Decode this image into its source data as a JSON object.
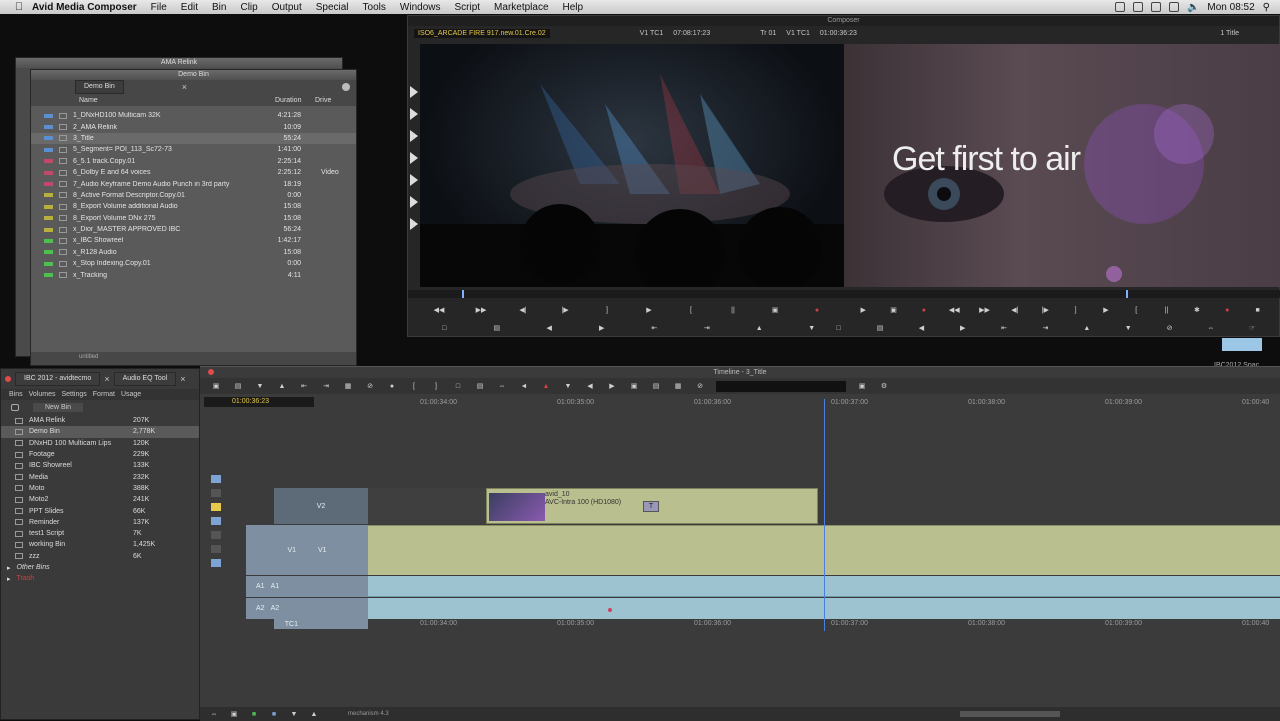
{
  "menubar": {
    "app_name": "Avid Media Composer",
    "menus": [
      "File",
      "Edit",
      "Bin",
      "Clip",
      "Output",
      "Special",
      "Tools",
      "Windows",
      "Script",
      "Marketplace",
      "Help"
    ],
    "clock": "Mon 08:52"
  },
  "bins": {
    "ama_title": "AMA Relink",
    "demo_title": "Demo Bin",
    "tab_label": "Demo Bin",
    "col_name": "Name",
    "col_duration": "Duration",
    "col_drive": "Drive",
    "footer_label": "untitled",
    "items": [
      {
        "name": "1_DNxHD100 Multicam 32K",
        "duration": "4:21:28",
        "color": "#5b8fd0",
        "sel": false
      },
      {
        "name": "2_AMA Relink",
        "duration": "10:09",
        "color": "#5b8fd0",
        "sel": false
      },
      {
        "name": "3_Title",
        "duration": "55:24",
        "color": "#5b8fd0",
        "sel": true
      },
      {
        "name": "5_Segment= POI_113_Sc72-73",
        "duration": "1:41:00",
        "color": "#5b8fd0",
        "sel": false
      },
      {
        "name": "6_5.1 track.Copy.01",
        "duration": "2:25:14",
        "color": "#c04a6a",
        "sel": false
      },
      {
        "name": "6_Dolby E and 64 voices",
        "duration": "2:25:12",
        "color": "#c04a6a",
        "sel": false
      },
      {
        "name": "7_Audio Keyframe Demo Audio Punch in 3rd party",
        "duration": "18:19",
        "color": "#c04a6a",
        "sel": false
      },
      {
        "name": "8_Active Format Descriptor.Copy.01",
        "duration": "0:00",
        "color": "#b7b040",
        "sel": false
      },
      {
        "name": "8_Export Volume additional Audio",
        "duration": "15:08",
        "color": "#b7b040",
        "sel": false
      },
      {
        "name": "8_Export Volume DNx 275",
        "duration": "15:08",
        "color": "#b7b040",
        "sel": false
      },
      {
        "name": "x_Dior_MASTER APPROVED IBC",
        "duration": "56:24",
        "color": "#b7b040",
        "sel": false
      },
      {
        "name": "x_IBC Showreel",
        "duration": "1:42:17",
        "color": "#4fc04f",
        "sel": false
      },
      {
        "name": "x_R128 Audio",
        "duration": "15:08",
        "color": "#4fc04f",
        "sel": false
      },
      {
        "name": "x_Stop Indexing.Copy.01",
        "duration": "0:00",
        "color": "#4fc04f",
        "sel": false
      },
      {
        "name": "x_Tracking",
        "duration": "4:11",
        "color": "#4fc04f",
        "sel": false
      }
    ],
    "drive_label": "Video"
  },
  "composer": {
    "title": "Composer",
    "source_name": "ISO6_ARCADE FIRE  917.new.01.Cre.02",
    "tc1_label": "V1  TC1",
    "tc1_value": "07:08:17:23",
    "tc2_label": "V1  TC1",
    "tc2_value": "01:00:36:23",
    "tr_label": "Tr 01",
    "mode_label": "1 Title",
    "overlay_text": "Get first to air"
  },
  "project": {
    "tab1": "IBC 2012 - avidtecmo",
    "tab2": "Audio EQ Tool",
    "subtabs": [
      "Bins",
      "Volumes",
      "Settings",
      "Format",
      "Usage"
    ],
    "new_bin": "New Bin",
    "items": [
      {
        "name": "AMA Relink",
        "size": "207K",
        "sel": false
      },
      {
        "name": "Demo Bin",
        "size": "2,778K",
        "sel": true
      },
      {
        "name": "DNxHD 100 Multicam Lips",
        "size": "120K",
        "sel": false
      },
      {
        "name": "Footage",
        "size": "229K",
        "sel": false
      },
      {
        "name": "IBC Showreel",
        "size": "133K",
        "sel": false
      },
      {
        "name": "Media",
        "size": "232K",
        "sel": false
      },
      {
        "name": "Moto",
        "size": "388K",
        "sel": false
      },
      {
        "name": "Moto2",
        "size": "241K",
        "sel": false
      },
      {
        "name": "PPT Slides",
        "size": "66K",
        "sel": false
      },
      {
        "name": "Reminder",
        "size": "137K",
        "sel": false
      },
      {
        "name": "test1 Script",
        "size": "7K",
        "sel": false
      },
      {
        "name": "working Bin",
        "size": "1,425K",
        "sel": false
      },
      {
        "name": "zzz",
        "size": "6K",
        "sel": false
      }
    ],
    "other_bins": "Other Bins",
    "trash": "Trash"
  },
  "timeline": {
    "title": "Timeline - 3_Title",
    "timecode": "01:00:36:23",
    "ticks": [
      "01:00:34:00",
      "01:00:35:00",
      "01:00:36:00",
      "01:00:37:00",
      "01:00:38:00",
      "01:00:39:00",
      "01:00:40"
    ],
    "clip_name": "avid_10",
    "clip_format": "AVC-Intra 100 (HD1080)",
    "tracks": {
      "v2": "V2",
      "v1": "V1",
      "a1": "A1",
      "a2": "A2",
      "tc1": "TC1"
    },
    "bottom_label": "mechanism 4.3",
    "side_text": "IBC2012 Spac"
  },
  "colors": {
    "accent": "#5b8fd0",
    "clip": "#b9bf8e",
    "audio": "#9ec3d0",
    "timecode": "#e6c84a"
  }
}
